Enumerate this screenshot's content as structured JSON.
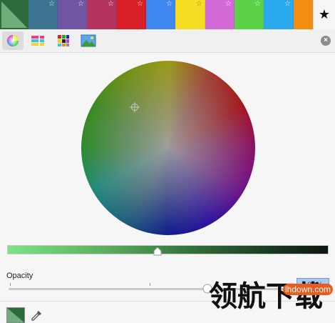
{
  "palette": {
    "swatches": [
      {
        "color": "#2e6b3b",
        "starred": false
      },
      {
        "color": "#3c7391",
        "starred": true
      },
      {
        "color": "#6f55a2",
        "starred": true
      },
      {
        "color": "#b3345f",
        "starred": true
      },
      {
        "color": "#d81f26",
        "starred": true
      },
      {
        "color": "#3f87ef",
        "starred": true
      },
      {
        "color": "#f7dc24",
        "starred": true
      },
      {
        "color": "#d36ad8",
        "starred": true
      },
      {
        "color": "#5bd147",
        "starred": true
      },
      {
        "color": "#2aa9ef",
        "starred": true
      },
      {
        "color": "#f08d12",
        "starred": false
      }
    ],
    "star_glyph": "☆",
    "favorites_glyph": "★"
  },
  "tabs": [
    {
      "name": "color-wheel"
    },
    {
      "name": "color-sliders"
    },
    {
      "name": "color-palettes"
    },
    {
      "name": "image-palettes"
    }
  ],
  "close_glyph": "×",
  "opacity": {
    "label": "Opacity",
    "value_text": "100%"
  },
  "watermark": {
    "text": "领航下载",
    "url": "lhdown.com"
  }
}
